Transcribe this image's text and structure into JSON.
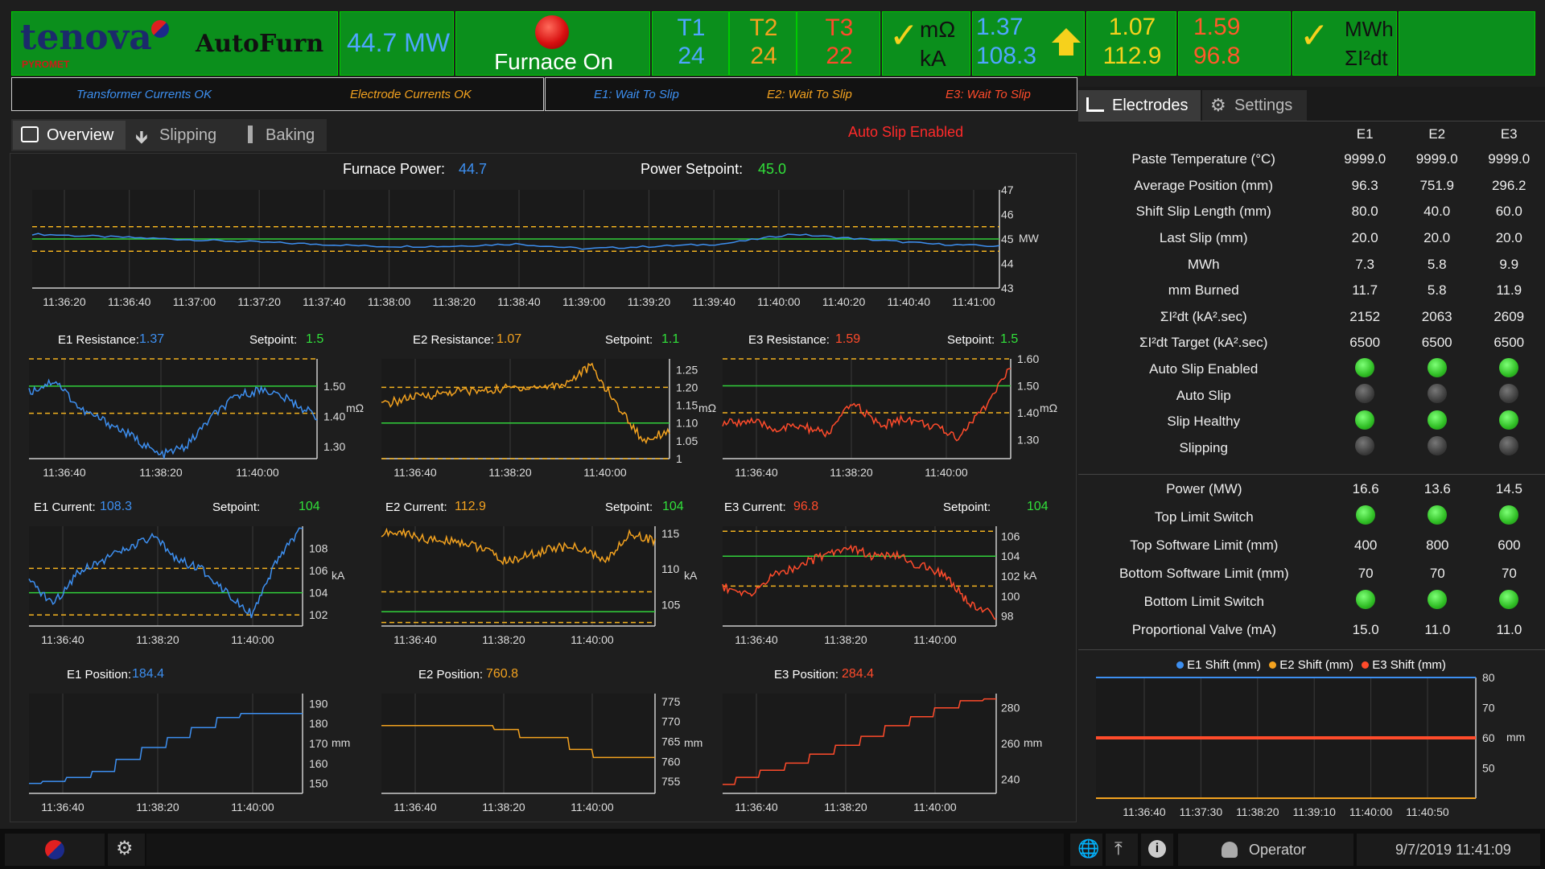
{
  "header": {
    "logo_text": "tenova",
    "logo_sub": "PYROMET",
    "app_name": "AutoFurn",
    "power": "44.7 MW",
    "furnace_status": "Furnace On",
    "t1_label": "T1",
    "t1_value": "24",
    "t2_label": "T2",
    "t2_value": "24",
    "t3_label": "T3",
    "t3_value": "22",
    "res_unit": "mΩ",
    "cur_unit": "kA",
    "e1_res": "1.37",
    "e1_cur": "108.3",
    "e2_res": "1.07",
    "e2_cur": "112.9",
    "e3_res": "1.59",
    "e3_cur": "96.8",
    "mwh_label": "MWh",
    "i2dt_label": "ΣI²dt"
  },
  "status": {
    "transformer": "Transformer Currents OK",
    "electrode": "Electrode Currents OK",
    "e1": "E1: Wait To Slip",
    "e2": "E2: Wait To Slip",
    "e3": "E3: Wait To Slip"
  },
  "tabs": {
    "overview": "Overview",
    "slipping": "Slipping",
    "baking": "Baking",
    "auto_slip": "Auto Slip Enabled"
  },
  "power_panel": {
    "label": "Furnace Power:",
    "value": "44.7",
    "setpoint_label": "Power Setpoint:",
    "setpoint": "45.0",
    "unit": "MW"
  },
  "right_tabs": {
    "electrodes": "Electrodes",
    "settings": "Settings"
  },
  "table": {
    "columns": [
      "E1",
      "E2",
      "E3"
    ],
    "rows1": [
      {
        "label": "Paste Temperature (°C)",
        "values": [
          "9999.0",
          "9999.0",
          "9999.0"
        ]
      },
      {
        "label": "Average Position (mm)",
        "values": [
          "96.3",
          "751.9",
          "296.2"
        ]
      },
      {
        "label": "Shift Slip Length (mm)",
        "values": [
          "80.0",
          "40.0",
          "60.0"
        ]
      },
      {
        "label": "Last Slip (mm)",
        "values": [
          "20.0",
          "20.0",
          "20.0"
        ]
      },
      {
        "label": "MWh",
        "values": [
          "7.3",
          "5.8",
          "9.9"
        ]
      },
      {
        "label": "mm Burned",
        "values": [
          "11.7",
          "5.8",
          "11.9"
        ]
      },
      {
        "label": "ΣI²dt (kA².sec)",
        "values": [
          "2152",
          "2063",
          "2609"
        ]
      },
      {
        "label": "ΣI²dt Target (kA².sec)",
        "values": [
          "6500",
          "6500",
          "6500"
        ]
      },
      {
        "label": "Auto Slip Enabled",
        "dots": [
          "on",
          "on",
          "on"
        ]
      },
      {
        "label": "Auto Slip",
        "dots": [
          "off",
          "off",
          "off"
        ]
      },
      {
        "label": "Slip Healthy",
        "dots": [
          "on",
          "on",
          "on"
        ]
      },
      {
        "label": "Slipping",
        "dots": [
          "off",
          "off",
          "off"
        ]
      }
    ],
    "rows2": [
      {
        "label": "Power (MW)",
        "values": [
          "16.6",
          "13.6",
          "14.5"
        ]
      },
      {
        "label": "Top Limit Switch",
        "dots": [
          "on",
          "on",
          "on"
        ]
      },
      {
        "label": "Top Software Limit (mm)",
        "values": [
          "400",
          "800",
          "600"
        ]
      },
      {
        "label": "Bottom Software Limit (mm)",
        "values": [
          "70",
          "70",
          "70"
        ]
      },
      {
        "label": "Bottom Limit Switch",
        "dots": [
          "on",
          "on",
          "on"
        ]
      },
      {
        "label": "Proportional Valve (mA)",
        "values": [
          "15.0",
          "11.0",
          "11.0"
        ]
      }
    ]
  },
  "small_labels": {
    "e1_res": "E1 Resistance:",
    "e1_res_v": "1.37",
    "e2_res": "E2 Resistance:",
    "e2_res_v": "1.07",
    "e3_res": "E3 Resistance:",
    "e3_res_v": "1.59",
    "sp": "Setpoint:",
    "e1_res_sp": "1.5",
    "e2_res_sp": "1.1",
    "e3_res_sp": "1.5",
    "e1_cur": "E1 Current:",
    "e1_cur_v": "108.3",
    "e2_cur": "E2 Current:",
    "e2_cur_v": "112.9",
    "e3_cur": "E3 Current:",
    "e3_cur_v": "96.8",
    "e1_cur_sp": "104",
    "e2_cur_sp": "104",
    "e3_cur_sp": "104",
    "e1_pos": "E1 Position:",
    "e1_pos_v": "184.4",
    "e2_pos": "E2 Position:",
    "e2_pos_v": "760.8",
    "e3_pos": "E3 Position:",
    "e3_pos_v": "284.4"
  },
  "footer": {
    "user": "Operator",
    "datetime": "9/7/2019 11:41:09"
  },
  "chart_data": [
    {
      "id": "power",
      "type": "line",
      "x": [
        "11:36:20",
        "11:36:40",
        "11:37:00",
        "11:37:20",
        "11:37:40",
        "11:38:00",
        "11:38:20",
        "11:38:40",
        "11:39:00",
        "11:39:20",
        "11:39:40",
        "11:40:00",
        "11:40:20",
        "11:40:40",
        "11:41:00"
      ],
      "yticks": [
        43,
        44,
        45,
        46,
        47
      ],
      "ylim": [
        43,
        47
      ],
      "unit": "MW",
      "setpoint": 45.0,
      "limits": [
        44.5,
        45.5
      ],
      "series": [
        {
          "values": [
            45.2,
            45.1,
            45.0,
            44.9,
            44.8,
            44.7,
            44.7,
            44.8,
            44.6,
            44.7,
            44.8,
            45.2,
            45.0,
            44.8,
            44.7
          ],
          "color": "#3d8ff0"
        }
      ]
    },
    {
      "id": "e1res",
      "type": "line",
      "x": [
        "11:36:40",
        "11:38:20",
        "11:40:00"
      ],
      "yticks": [
        1.3,
        1.4,
        1.5
      ],
      "ylabels": [
        "1.30",
        "1.40",
        "1.50"
      ],
      "ylim": [
        1.26,
        1.59
      ],
      "unit": "mΩ",
      "setpoint": 1.5,
      "limits": [
        1.41,
        1.59
      ],
      "series": [
        {
          "values": [
            1.48,
            1.52,
            1.42,
            1.38,
            1.33,
            1.27,
            1.3,
            1.4,
            1.47,
            1.49,
            1.45,
            1.4
          ],
          "color": "#3d8ff0"
        }
      ]
    },
    {
      "id": "e2res",
      "type": "line",
      "x": [
        "11:36:40",
        "11:38:20",
        "11:40:00"
      ],
      "yticks": [
        1.0,
        1.05,
        1.1,
        1.15,
        1.2,
        1.25
      ],
      "ylabels": [
        "1",
        "1.05",
        "1.10",
        "1.15",
        "1.20",
        "1.25"
      ],
      "ylim": [
        1.0,
        1.28
      ],
      "unit": "mΩ",
      "setpoint": 1.1,
      "limits": [
        1.0,
        1.2
      ],
      "series": [
        {
          "values": [
            1.15,
            1.17,
            1.18,
            1.19,
            1.19,
            1.2,
            1.2,
            1.21,
            1.26,
            1.15,
            1.05,
            1.08
          ],
          "color": "#f3a21f"
        }
      ]
    },
    {
      "id": "e3res",
      "type": "line",
      "x": [
        "11:36:40",
        "11:38:20",
        "11:40:00"
      ],
      "yticks": [
        1.3,
        1.4,
        1.5,
        1.6
      ],
      "ylabels": [
        "1.30",
        "1.40",
        "1.50",
        "1.60"
      ],
      "ylim": [
        1.23,
        1.6
      ],
      "unit": "mΩ",
      "setpoint": 1.5,
      "limits": [
        1.4,
        1.6
      ],
      "series": [
        {
          "values": [
            1.36,
            1.37,
            1.34,
            1.35,
            1.32,
            1.44,
            1.35,
            1.38,
            1.35,
            1.31,
            1.42,
            1.57
          ],
          "color": "#ff4b2b"
        }
      ]
    },
    {
      "id": "e1cur",
      "type": "line",
      "x": [
        "11:36:40",
        "11:38:20",
        "11:40:00"
      ],
      "yticks": [
        102,
        104,
        106,
        108
      ],
      "ylim": [
        101,
        110
      ],
      "unit": "kA",
      "setpoint": 104,
      "limits": [
        102,
        106.2
      ],
      "series": [
        {
          "values": [
            105,
            103,
            106,
            107,
            108,
            109,
            107,
            106,
            104,
            102,
            107,
            110
          ],
          "color": "#3d8ff0"
        }
      ]
    },
    {
      "id": "e2cur",
      "type": "line",
      "x": [
        "11:36:40",
        "11:38:20",
        "11:40:00"
      ],
      "yticks": [
        105,
        110,
        115
      ],
      "ylim": [
        102,
        116
      ],
      "unit": "kA",
      "setpoint": 104,
      "limits": [
        102.5,
        106.8
      ],
      "series": [
        {
          "values": [
            115,
            115,
            114,
            114,
            113,
            111,
            112,
            113,
            113,
            111,
            115,
            114
          ],
          "color": "#f3a21f"
        }
      ]
    },
    {
      "id": "e3cur",
      "type": "line",
      "x": [
        "11:36:40",
        "11:38:20",
        "11:40:00"
      ],
      "yticks": [
        98,
        100,
        102,
        104,
        106
      ],
      "ylim": [
        97,
        107
      ],
      "unit": "kA",
      "setpoint": 104,
      "limits": [
        101,
        106.5
      ],
      "series": [
        {
          "values": [
            101,
            100,
            102,
            103,
            104,
            105,
            104,
            104,
            103,
            102,
            99,
            98
          ],
          "color": "#ff4b2b"
        }
      ]
    },
    {
      "id": "e1pos",
      "type": "line",
      "x": [
        "11:36:40",
        "11:38:20",
        "11:40:00"
      ],
      "yticks": [
        150,
        160,
        170,
        180,
        190
      ],
      "ylim": [
        145,
        195
      ],
      "unit": "mm",
      "series": [
        {
          "values": [
            150,
            151,
            153,
            156,
            162,
            168,
            173,
            178,
            183,
            185,
            185,
            185
          ],
          "color": "#3d8ff0"
        }
      ]
    },
    {
      "id": "e2pos",
      "type": "line",
      "x": [
        "11:36:40",
        "11:38:20",
        "11:40:00"
      ],
      "yticks": [
        755,
        760,
        765,
        770,
        775
      ],
      "ylim": [
        752,
        777
      ],
      "unit": "mm",
      "series": [
        {
          "values": [
            769,
            769,
            769,
            769,
            769,
            768,
            766,
            766,
            763,
            761,
            761,
            761
          ],
          "color": "#f3a21f"
        }
      ]
    },
    {
      "id": "e3pos",
      "type": "line",
      "x": [
        "11:36:40",
        "11:38:20",
        "11:40:00"
      ],
      "yticks": [
        240,
        260,
        280
      ],
      "ylim": [
        232,
        288
      ],
      "unit": "mm",
      "series": [
        {
          "values": [
            237,
            241,
            245,
            249,
            254,
            259,
            264,
            270,
            275,
            280,
            284,
            285
          ],
          "color": "#ff4b2b"
        }
      ]
    },
    {
      "id": "shift",
      "type": "line",
      "x": [
        "11:36:40",
        "11:37:30",
        "11:38:20",
        "11:39:10",
        "11:40:00",
        "11:40:50"
      ],
      "yticks": [
        50,
        60,
        70,
        80
      ],
      "ylim": [
        40,
        80
      ],
      "unit": "mm",
      "legend": [
        "E1 Shift (mm)",
        "E2 Shift (mm)",
        "E3 Shift (mm)"
      ],
      "series": [
        {
          "name": "E1 Shift (mm)",
          "values": [
            80,
            80,
            80,
            80,
            80,
            80,
            80
          ],
          "color": "#3d8ff0"
        },
        {
          "name": "E2 Shift (mm)",
          "values": [
            40,
            40,
            40,
            40,
            40,
            40,
            40
          ],
          "color": "#f3a21f"
        },
        {
          "name": "E3 Shift (mm)",
          "values": [
            60,
            60,
            60,
            60,
            60,
            60,
            60
          ],
          "color": "#ff4b2b"
        }
      ]
    }
  ]
}
